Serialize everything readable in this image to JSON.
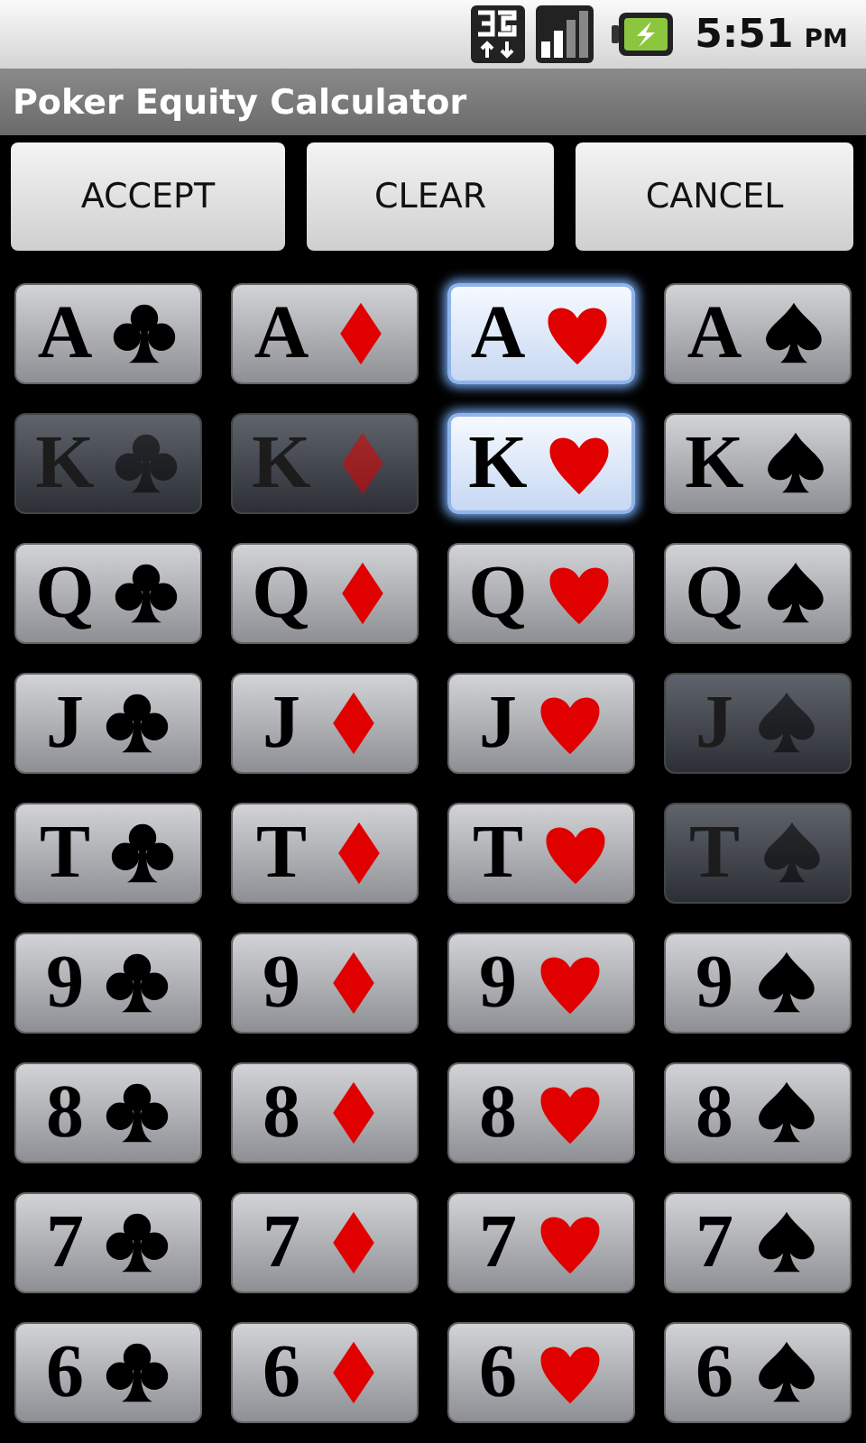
{
  "status_bar": {
    "time": "5:51",
    "ampm": "PM"
  },
  "window": {
    "title": "Poker Equity Calculator"
  },
  "buttons": [
    "ACCEPT",
    "CLEAR",
    "CANCEL"
  ],
  "card_rows": [
    [
      {
        "rank": "A",
        "kind": "clubs",
        "selected": false,
        "disabled": false
      },
      {
        "rank": "A",
        "kind": "diamonds",
        "selected": false,
        "disabled": false
      },
      {
        "rank": "A",
        "kind": "hearts",
        "selected": true,
        "disabled": false
      },
      {
        "rank": "A",
        "kind": "spades",
        "selected": false,
        "disabled": false
      }
    ],
    [
      {
        "rank": "K",
        "kind": "clubs",
        "selected": false,
        "disabled": true
      },
      {
        "rank": "K",
        "kind": "diamonds",
        "selected": false,
        "disabled": true
      },
      {
        "rank": "K",
        "kind": "hearts",
        "selected": true,
        "disabled": false
      },
      {
        "rank": "K",
        "kind": "spades",
        "selected": false,
        "disabled": false
      }
    ],
    [
      {
        "rank": "Q",
        "kind": "clubs",
        "selected": false,
        "disabled": false
      },
      {
        "rank": "Q",
        "kind": "diamonds",
        "selected": false,
        "disabled": false
      },
      {
        "rank": "Q",
        "kind": "hearts",
        "selected": false,
        "disabled": false
      },
      {
        "rank": "Q",
        "kind": "spades",
        "selected": false,
        "disabled": false
      }
    ],
    [
      {
        "rank": "J",
        "kind": "clubs",
        "selected": false,
        "disabled": false
      },
      {
        "rank": "J",
        "kind": "diamonds",
        "selected": false,
        "disabled": false
      },
      {
        "rank": "J",
        "kind": "hearts",
        "selected": false,
        "disabled": false
      },
      {
        "rank": "J",
        "kind": "spades",
        "selected": false,
        "disabled": true
      }
    ],
    [
      {
        "rank": "T",
        "kind": "clubs",
        "selected": false,
        "disabled": false
      },
      {
        "rank": "T",
        "kind": "diamonds",
        "selected": false,
        "disabled": false
      },
      {
        "rank": "T",
        "kind": "hearts",
        "selected": false,
        "disabled": false
      },
      {
        "rank": "T",
        "kind": "spades",
        "selected": false,
        "disabled": true
      }
    ],
    [
      {
        "rank": "9",
        "kind": "clubs",
        "selected": false,
        "disabled": false
      },
      {
        "rank": "9",
        "kind": "diamonds",
        "selected": false,
        "disabled": false
      },
      {
        "rank": "9",
        "kind": "hearts",
        "selected": false,
        "disabled": false
      },
      {
        "rank": "9",
        "kind": "spades",
        "selected": false,
        "disabled": false
      }
    ],
    [
      {
        "rank": "8",
        "kind": "clubs",
        "selected": false,
        "disabled": false
      },
      {
        "rank": "8",
        "kind": "diamonds",
        "selected": false,
        "disabled": false
      },
      {
        "rank": "8",
        "kind": "hearts",
        "selected": false,
        "disabled": false
      },
      {
        "rank": "8",
        "kind": "spades",
        "selected": false,
        "disabled": false
      }
    ],
    [
      {
        "rank": "7",
        "kind": "clubs",
        "selected": false,
        "disabled": false
      },
      {
        "rank": "7",
        "kind": "diamonds",
        "selected": false,
        "disabled": false
      },
      {
        "rank": "7",
        "kind": "hearts",
        "selected": false,
        "disabled": false
      },
      {
        "rank": "7",
        "kind": "spades",
        "selected": false,
        "disabled": false
      }
    ],
    [
      {
        "rank": "6",
        "kind": "clubs",
        "selected": false,
        "disabled": false
      },
      {
        "rank": "6",
        "kind": "diamonds",
        "selected": false,
        "disabled": false
      },
      {
        "rank": "6",
        "kind": "hearts",
        "selected": false,
        "disabled": false
      },
      {
        "rank": "6",
        "kind": "spades",
        "selected": false,
        "disabled": false
      }
    ]
  ]
}
